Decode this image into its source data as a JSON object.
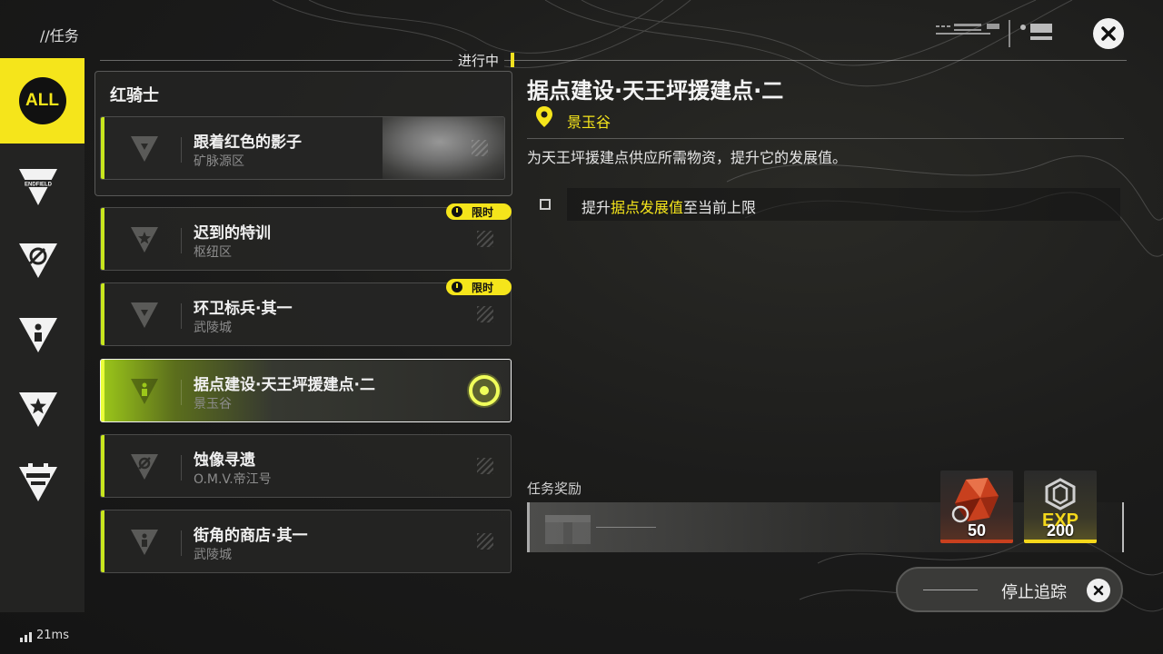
{
  "header": {
    "title": "//任务"
  },
  "status": {
    "label": "进行中"
  },
  "sidebar": {
    "items": [
      {
        "label": "ALL",
        "icon": "all-icon",
        "active": true
      },
      {
        "label": "ENDFIELD",
        "icon": "endfield-icon"
      },
      {
        "icon": "rotate-icon"
      },
      {
        "icon": "person-icon"
      },
      {
        "icon": "star-icon"
      },
      {
        "icon": "battery-icon"
      }
    ]
  },
  "group": {
    "title": "红骑士"
  },
  "quests": [
    {
      "name": "跟着红色的影子",
      "location": "矿脉源区",
      "icon": "triangle-icon"
    },
    {
      "name": "迟到的特训",
      "location": "枢纽区",
      "badge": "限时",
      "icon": "star-triangle-icon"
    },
    {
      "name": "环卫标兵·其一",
      "location": "武陵城",
      "badge": "限时",
      "icon": "triangle-icon"
    },
    {
      "name": "据点建设·天王坪援建点·二",
      "location": "景玉谷",
      "active": true,
      "icon": "person-triangle-icon"
    },
    {
      "name": "蚀像寻遗",
      "location": "O.M.V.帝江号",
      "icon": "rotate-triangle-icon"
    },
    {
      "name": "街角的商店·其一",
      "location": "武陵城",
      "icon": "person-triangle-icon"
    }
  ],
  "detail": {
    "title": "据点建设·天王坪援建点·二",
    "location": "景玉谷",
    "description": "为天王坪援建点供应所需物资，提升它的发展值。",
    "objective": {
      "prefix": "提升",
      "highlight": "据点发展值",
      "suffix": "至当前上限"
    }
  },
  "rewards": {
    "label": "任务奖励",
    "items": [
      {
        "name": "crystal-reward",
        "qty": "50",
        "color": "#c8401e"
      },
      {
        "name": "exp-reward",
        "word": "EXP",
        "qty": "200",
        "color": "#f5d81b"
      }
    ]
  },
  "actions": {
    "stop_tracking": "停止追踪"
  },
  "network": {
    "ping": "21ms"
  },
  "colors": {
    "accent_yellow": "#f5e51b",
    "accent_green": "#c8e61e"
  }
}
